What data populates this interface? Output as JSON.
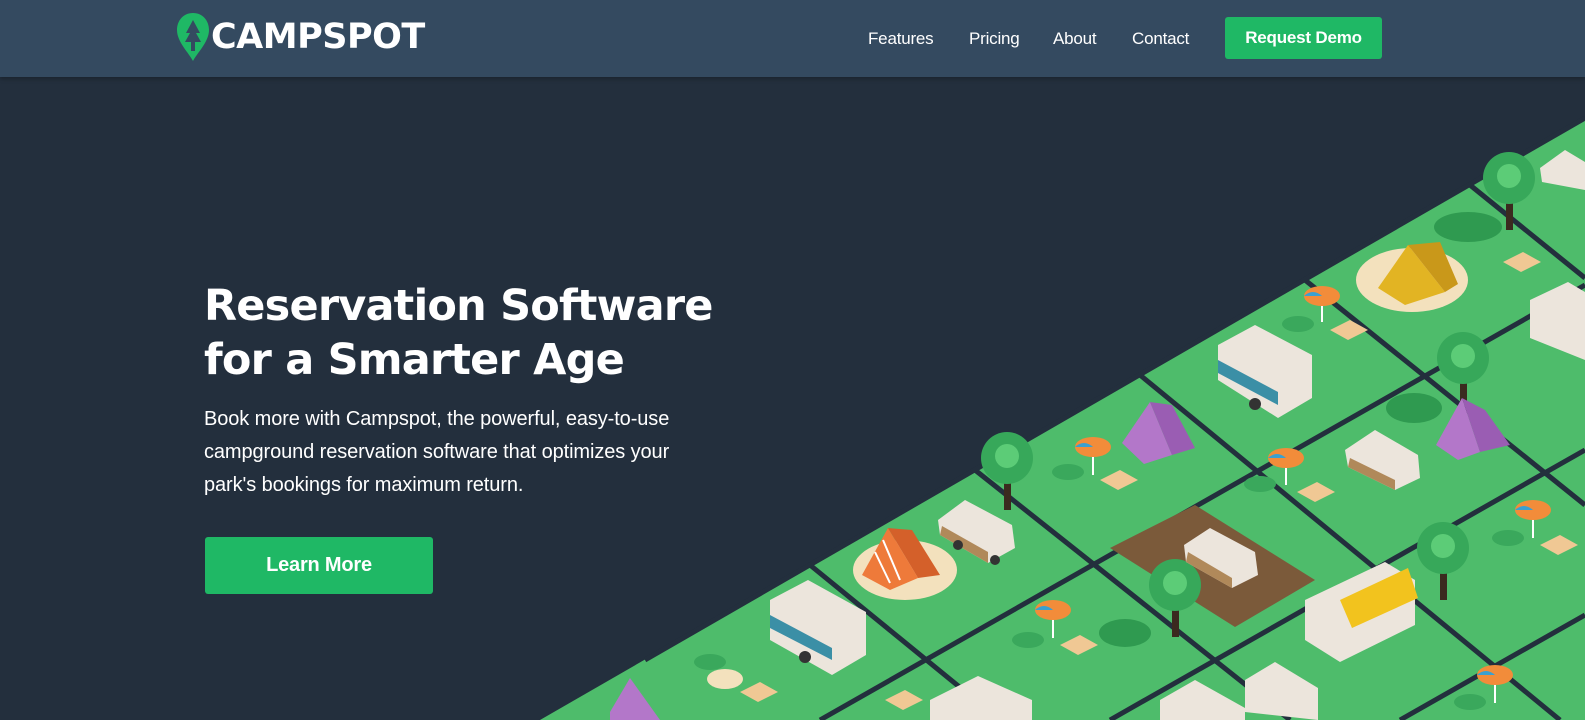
{
  "header": {
    "logo_text": "CAMPSPOT",
    "nav": [
      {
        "label": "Features"
      },
      {
        "label": "Pricing"
      },
      {
        "label": "About"
      },
      {
        "label": "Contact"
      }
    ],
    "cta_label": "Request Demo"
  },
  "hero": {
    "title_lines": [
      "Reservation Software",
      "for a Smarter Age"
    ],
    "body_lines": [
      "Book more with Campspot, the powerful, easy-to-use",
      "campground reservation software that optimizes your",
      "park's bookings for maximum return."
    ],
    "button_label": "Learn More"
  },
  "colors": {
    "background": "#232f3d",
    "header": "#344a60",
    "accent": "#1fb865",
    "grass": "#4ebc6b",
    "grid_lines": "#232f3d"
  },
  "illustration": {
    "subject": "isometric-campground-map",
    "icons": [
      "tree-icon",
      "tent-icon",
      "rv-icon",
      "car-icon",
      "umbrella-icon",
      "picnic-table-icon",
      "chair-icon"
    ]
  }
}
